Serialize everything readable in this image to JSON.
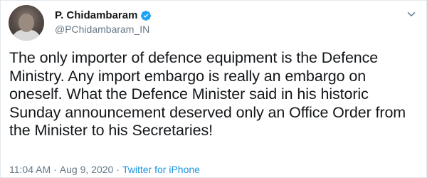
{
  "tweet": {
    "name": "P. Chidambaram",
    "handle": "@PChidambaram_IN",
    "text": "The only importer of defence equipment is the Defence Ministry. Any import embargo is really an embargo on oneself. What the Defence Minister said in his historic Sunday announcement deserved only an Office Order from the Minister to his Secretaries!",
    "time": "11:04 AM",
    "separator": "·",
    "date": "Aug 9, 2020",
    "source": "Twitter for iPhone"
  },
  "colors": {
    "verified": "#1da1f2",
    "link": "#1b95e0",
    "muted": "#657786"
  },
  "icons": {
    "verified": "verified-badge-icon",
    "menu": "chevron-down-icon"
  }
}
